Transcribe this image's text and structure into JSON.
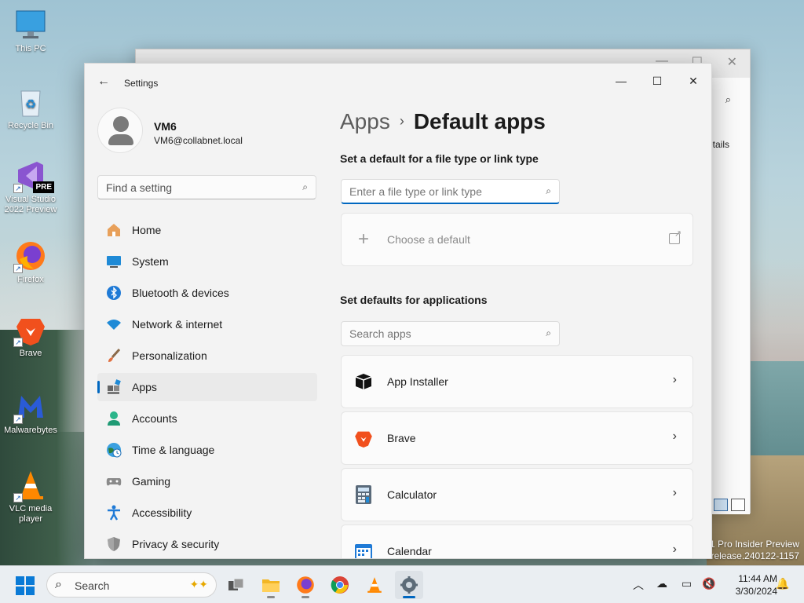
{
  "desktop": {
    "icons": [
      {
        "label": "This PC"
      },
      {
        "label": "Recycle Bin"
      },
      {
        "label": "Visual Studio 2022 Preview",
        "badge": "PRE"
      },
      {
        "label": "Firefox"
      },
      {
        "label": "Brave"
      },
      {
        "label": "Malwarebytes"
      },
      {
        "label": "VLC media player"
      }
    ],
    "watermark": {
      "line1": "1 Pro Insider Preview",
      "line2": "erelease.240122-1157"
    }
  },
  "background_window": {
    "details_label": "etails"
  },
  "settings": {
    "title": "Settings",
    "profile": {
      "name": "VM6",
      "email": "VM6@collabnet.local"
    },
    "find_placeholder": "Find a setting",
    "nav": [
      {
        "label": "Home"
      },
      {
        "label": "System"
      },
      {
        "label": "Bluetooth & devices"
      },
      {
        "label": "Network & internet"
      },
      {
        "label": "Personalization"
      },
      {
        "label": "Apps"
      },
      {
        "label": "Accounts"
      },
      {
        "label": "Time & language"
      },
      {
        "label": "Gaming"
      },
      {
        "label": "Accessibility"
      },
      {
        "label": "Privacy & security"
      }
    ],
    "active_nav": "Apps",
    "breadcrumb": {
      "parent": "Apps",
      "separator": "›",
      "current": "Default apps"
    },
    "filetype_section": {
      "heading": "Set a default for a file type or link type",
      "placeholder": "Enter a file type or link type",
      "choose_label": "Choose a default"
    },
    "apps_section": {
      "heading": "Set defaults for applications",
      "search_placeholder": "Search apps",
      "apps": [
        {
          "name": "App Installer",
          "icon": "box-icon"
        },
        {
          "name": "Brave",
          "icon": "brave-lion-icon"
        },
        {
          "name": "Calculator",
          "icon": "calculator-icon"
        },
        {
          "name": "Calendar",
          "icon": "calendar-icon"
        }
      ]
    }
  },
  "taskbar": {
    "search_label": "Search",
    "clock_time": "11:44 AM",
    "clock_date": "3/30/2024",
    "accent": "#0067c0"
  }
}
